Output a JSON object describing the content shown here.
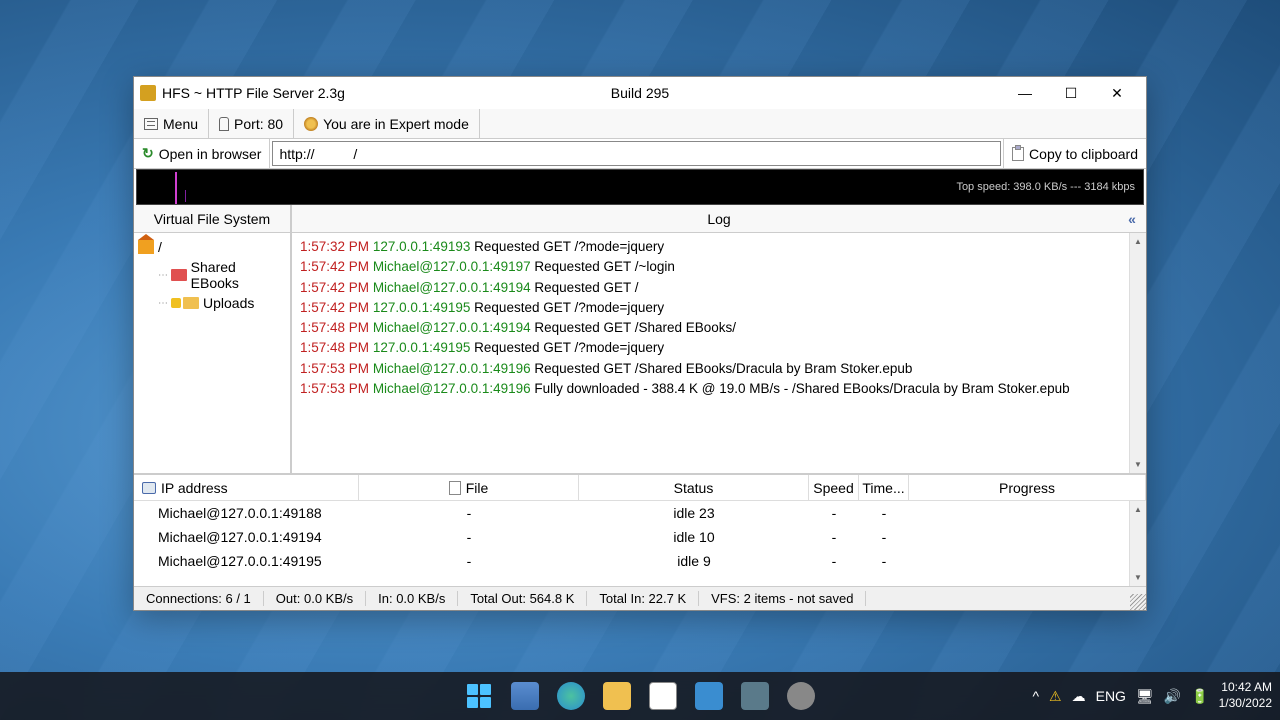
{
  "window": {
    "title": "HFS ~ HTTP File Server 2.3g",
    "build": "Build 295"
  },
  "toolbar": {
    "menu": "Menu",
    "port": "Port: 80",
    "mode": "You are in Expert mode"
  },
  "urlbar": {
    "open_browser": "Open in browser",
    "url_prefix": "http://",
    "url_suffix": "/",
    "copy": "Copy to clipboard"
  },
  "graph": {
    "text": "Top speed: 398.0 KB/s   ---   3184 kbps"
  },
  "vfs": {
    "header": "Virtual File System",
    "root": "/",
    "items": [
      {
        "label": "Shared EBooks"
      },
      {
        "label": "Uploads"
      }
    ]
  },
  "log": {
    "header": "Log",
    "lines": [
      {
        "time": "1:57:32 PM",
        "who": "127.0.0.1:49193",
        "msg": "Requested GET /?mode=jquery",
        "is_user": false
      },
      {
        "time": "1:57:42 PM",
        "who": "Michael@127.0.0.1:49197",
        "msg": "Requested GET /~login",
        "is_user": true
      },
      {
        "time": "1:57:42 PM",
        "who": "Michael@127.0.0.1:49194",
        "msg": "Requested GET /",
        "is_user": true
      },
      {
        "time": "1:57:42 PM",
        "who": "127.0.0.1:49195",
        "msg": "Requested GET /?mode=jquery",
        "is_user": false
      },
      {
        "time": "1:57:48 PM",
        "who": "Michael@127.0.0.1:49194",
        "msg": "Requested GET /Shared EBooks/",
        "is_user": true
      },
      {
        "time": "1:57:48 PM",
        "who": "127.0.0.1:49195",
        "msg": "Requested GET /?mode=jquery",
        "is_user": false
      },
      {
        "time": "1:57:53 PM",
        "who": "Michael@127.0.0.1:49196",
        "msg": "Requested GET /Shared EBooks/Dracula by Bram Stoker.epub",
        "is_user": true
      },
      {
        "time": "1:57:53 PM",
        "who": "Michael@127.0.0.1:49196",
        "msg": "Fully downloaded - 388.4 K @ 19.0 MB/s - /Shared EBooks/Dracula by Bram Stoker.epub",
        "is_user": true
      }
    ]
  },
  "conn": {
    "headers": {
      "ip": "IP address",
      "file": "File",
      "status": "Status",
      "speed": "Speed",
      "time": "Time...",
      "progress": "Progress"
    },
    "rows": [
      {
        "ip": "Michael@127.0.0.1:49188",
        "file": "-",
        "status": "idle 23",
        "speed": "-",
        "time": "-",
        "progress": ""
      },
      {
        "ip": "Michael@127.0.0.1:49194",
        "file": "-",
        "status": "idle 10",
        "speed": "-",
        "time": "-",
        "progress": ""
      },
      {
        "ip": "Michael@127.0.0.1:49195",
        "file": "-",
        "status": "idle 9",
        "speed": "-",
        "time": "-",
        "progress": ""
      }
    ]
  },
  "status": {
    "connections": "Connections: 6 / 1",
    "out": "Out: 0.0 KB/s",
    "in": "In: 0.0 KB/s",
    "total_out": "Total Out: 564.8 K",
    "total_in": "Total In: 22.7 K",
    "vfs": "VFS: 2 items - not saved"
  },
  "taskbar": {
    "lang": "ENG",
    "time": "10:42 AM",
    "date": "1/30/2022"
  }
}
